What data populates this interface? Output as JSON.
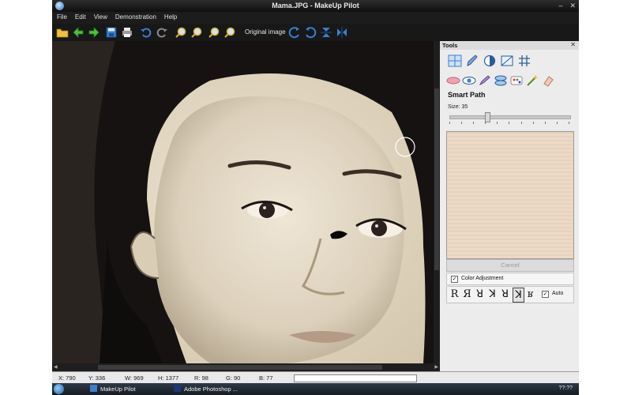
{
  "window": {
    "title": "Mama.JPG - MakeUp Pilot"
  },
  "menu": [
    "File",
    "Edit",
    "View",
    "Demonstration",
    "Help"
  ],
  "toolbar": {
    "original_label": "Original image"
  },
  "tools_panel": {
    "title": "Tools",
    "tool_name": "Smart Path",
    "size_label": "Size: 35",
    "size_value": 35,
    "size_fraction": 0.3,
    "cancel_label": "Cancel",
    "color_adjustment_label": "Color Adjustment",
    "color_adjustment_checked": true,
    "glyphs": [
      "R",
      "Я",
      "ꓤ",
      "ꓘ",
      "ꓤ",
      "ꓘ",
      "ʁ"
    ],
    "auto_label": "Auto",
    "auto_checked": true
  },
  "status": {
    "x": "X: 790",
    "y": "Y: 336",
    "w": "W: 969",
    "h": "H: 1377",
    "r": "R: 98",
    "g": "G: 90",
    "b": "B: 77"
  },
  "taskbar": {
    "items": [
      "MakeUp Pilot",
      "Adobe Photoshop ..."
    ],
    "clock": "??:??"
  },
  "colors": {
    "window_bg": "#1b1b1b",
    "panel_bg": "#ececec",
    "accent_blue": "#3a7fd0"
  }
}
